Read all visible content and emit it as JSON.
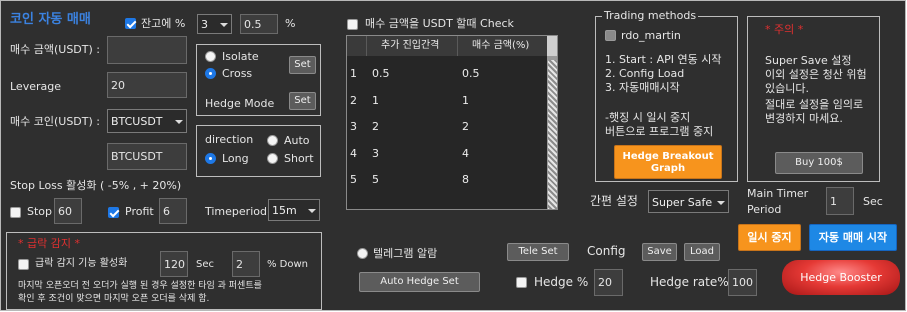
{
  "header": {
    "title": "코인 자동 매매"
  },
  "balance_ratio": {
    "label": "잔고에 %",
    "checked": true,
    "percent_value": "3",
    "ratio_value": "0.5",
    "percent_sign": "%"
  },
  "buy_amount": {
    "label": "매수 금액(USDT) :",
    "value": ""
  },
  "leverage": {
    "label": "Leverage",
    "value": "20"
  },
  "buy_coin": {
    "label": "매수 코인(USDT) :",
    "selected": "BTCUSDT",
    "value": "BTCUSDT"
  },
  "margin_mode": {
    "isolate": "Isolate",
    "cross": "Cross",
    "set_label": "Set",
    "selected": "Cross"
  },
  "hedge_mode": {
    "label": "Hedge Mode",
    "set_label": "Set"
  },
  "direction": {
    "label": "direction",
    "auto": "Auto",
    "long": "Long",
    "short": "Short",
    "selected": "Long"
  },
  "stop_loss": {
    "label": "Stop Loss 활성화 ( -5% , + 20%)"
  },
  "stop": {
    "label": "Stop",
    "checked": false,
    "value": "60"
  },
  "profit": {
    "label": "Profit",
    "checked": true,
    "value": "6"
  },
  "timeperiod": {
    "label": "Timeperiod",
    "selected": "15m"
  },
  "sudden": {
    "title": "* 급락 감지 *",
    "enable_label": "급락 감지 기능 활성화",
    "enabled": false,
    "sec_value": "120",
    "sec_unit": "Sec",
    "pct_value": "2",
    "pct_unit": "% Down",
    "note_line1": "마지막 오픈오더 전 오더가 실행 된 경우 설정한 타임 과 퍼센트를",
    "note_line2": "확인 후 조건이 맞으면 마지막 오픈 오더를 삭제 함."
  },
  "usdt_check": {
    "label": "매수 금액을 USDT 할때 Check",
    "checked": false
  },
  "table": {
    "headers": [
      "추가 진입간격",
      "매수 금액(%)"
    ],
    "rows": [
      {
        "idx": "1",
        "interval": "0.5",
        "amount": "0.5"
      },
      {
        "idx": "2",
        "interval": "1",
        "amount": "1"
      },
      {
        "idx": "3",
        "interval": "2",
        "amount": "2"
      },
      {
        "idx": "4",
        "interval": "3",
        "amount": "4"
      },
      {
        "idx": "5",
        "interval": "5",
        "amount": "8"
      }
    ]
  },
  "telegram": {
    "label": "텔레그램 알람",
    "selected": false
  },
  "auto_hedge_label": "Auto Hedge Set",
  "trading_methods": {
    "title": "Trading methods",
    "user": "rdo_martin",
    "user_checked": false,
    "line1": "1. Start : API 연동 시작",
    "line2": "2. Config Load",
    "line3": "3. 자동매매시작",
    "line4": "-햇징 시 일시 중지",
    "line5": " 버튼으로 프로그램 중지",
    "hedge_breakout_line1": "Hedge Breakout",
    "hedge_breakout_line2": "Graph"
  },
  "notice": {
    "title": "* 주의 *",
    "line1": "Super Save 설정",
    "line2": "이외 설정은 청산 위험",
    "line3": "있습니다.",
    "line4": "절대로 설정을 임의로",
    "line5": "변경하지 마세요.",
    "buy_label": "Buy 100$"
  },
  "simple_settings": {
    "label": "간편 설정",
    "selected": "Super Safe"
  },
  "main_timer": {
    "label_line1": "Main Timer",
    "label_line2": "Period",
    "value": "1",
    "unit": "Sec"
  },
  "tele_set_label": "Tele Set",
  "config": {
    "label": "Config",
    "save_label": "Save",
    "load_label": "Load"
  },
  "pause_label": "일시 중지",
  "auto_start_label": "자동 매매 시작",
  "hedge_pct": {
    "label": "Hedge %",
    "checked": false,
    "value": "20"
  },
  "hedge_rate": {
    "label": "Hedge rate%",
    "value": "100"
  },
  "hedge_booster_label": "Hedge Booster",
  "colors": {
    "background": "#2f2f2f",
    "title_blue": "#3b82e0",
    "checkbox_blue": "#1e78e6",
    "notice_red": "#e03030",
    "orange_button": "#f7941d",
    "blue_button": "#1e88e5",
    "booster_red": "#e0262a"
  }
}
